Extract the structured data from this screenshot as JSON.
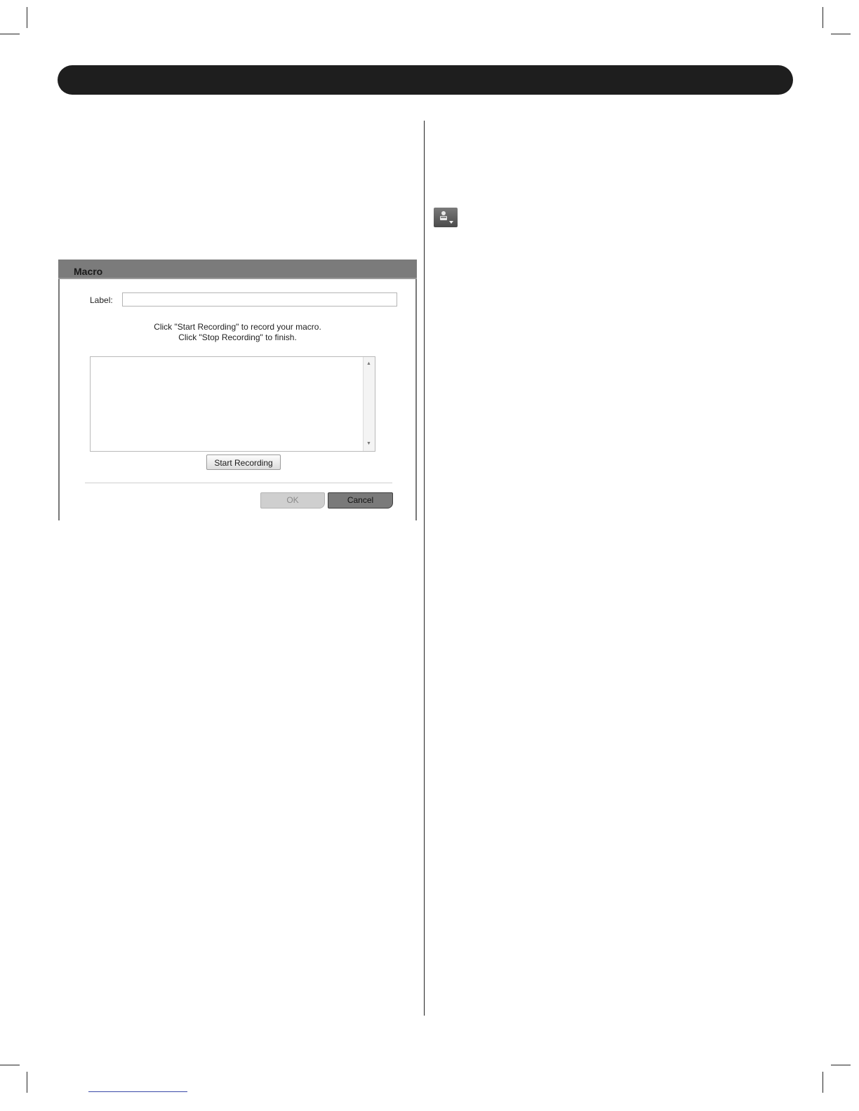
{
  "dialog": {
    "title": "Macro",
    "label_caption": "Label:",
    "label_value": "",
    "instruction_line1": "Click \"Start Recording\" to record your macro.",
    "instruction_line2": "Click \"Stop Recording\" to finish.",
    "start_button": "Start Recording",
    "ok_button": "OK",
    "cancel_button": "Cancel"
  },
  "icons": {
    "toolbar_macro": "macro-keyboard-icon",
    "scroll_up": "scroll-up-arrow-icon",
    "scroll_down": "scroll-down-arrow-icon"
  },
  "colors": {
    "header_bar": "#1e1e1e",
    "titlebar": "#7b7b7b",
    "ok_disabled": "#cfcfcf",
    "cancel": "#7a7a7a"
  }
}
